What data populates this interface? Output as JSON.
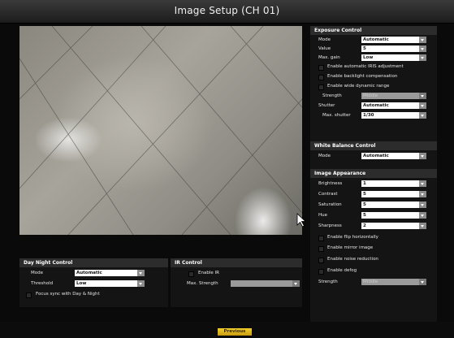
{
  "title": "Image Setup (CH 01)",
  "exposure": {
    "header": "Exposure Control",
    "mode_label": "Mode",
    "mode_value": "Automatic",
    "value_label": "Value",
    "value_value": "5",
    "maxgain_label": "Max. gain",
    "maxgain_value": "Low",
    "iris_label": "Enable automatic IRIS adjustment",
    "backlight_label": "Enable backlight compensation",
    "wdr_label": "Enable wide dynamic range",
    "strength_label": "Strength",
    "strength_value": "Middle",
    "shutter_label": "Shutter",
    "shutter_value": "Automatic",
    "maxshutter_label": "Max. shutter",
    "maxshutter_value": "1/30"
  },
  "white_balance": {
    "header": "White Balance Control",
    "mode_label": "Mode",
    "mode_value": "Automatic"
  },
  "appearance": {
    "header": "Image Appearance",
    "brightness_label": "Brightness",
    "brightness_value": "1",
    "contrast_label": "Contrast",
    "contrast_value": "5",
    "saturation_label": "Saturation",
    "saturation_value": "5",
    "hue_label": "Hue",
    "hue_value": "5",
    "sharpness_label": "Sharpness",
    "sharpness_value": "2",
    "flip_label": "Enable flip horizontally",
    "mirror_label": "Enable mirror image",
    "noise_label": "Enable noise reduction",
    "defog_label": "Enable defog",
    "strength_label": "Strength",
    "strength_value": "Middle"
  },
  "day_night": {
    "header": "Day Night Control",
    "mode_label": "Mode",
    "mode_value": "Automatic",
    "threshold_label": "Threshold",
    "threshold_value": "Low",
    "focus_label": "Focus sync with Day & Night"
  },
  "ir": {
    "header": "IR Control",
    "enable_label": "Enable IR",
    "maxstrength_label": "Max. Strength",
    "maxstrength_value": ""
  },
  "footer": {
    "previous_label": "Previous"
  },
  "icons": {
    "dropdown": "chevron-down-icon",
    "cursor": "mouse-pointer-icon",
    "checkbox": "checkbox-icon"
  }
}
